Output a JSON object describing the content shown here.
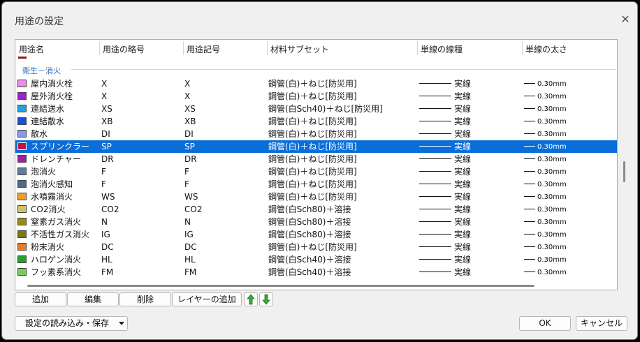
{
  "dialog": {
    "title": "用途の設定",
    "close_glyph": "✕"
  },
  "columns": [
    "用途名",
    "用途の略号",
    "用途記号",
    "材料サブセット",
    "単線の線種",
    "単線の太さ"
  ],
  "group_label": "衛生－消火",
  "rows": [
    {
      "name": "屋内消火栓",
      "abbr": "X",
      "symbol": "X",
      "subset": "鋼管(白)＋ねじ[防災用]",
      "linetype": "実線",
      "thickness": "0.30mm",
      "color": "#ee8be8"
    },
    {
      "name": "屋外消火栓",
      "abbr": "X",
      "symbol": "X",
      "subset": "鋼管(白)＋ねじ[防災用]",
      "linetype": "実線",
      "thickness": "0.30mm",
      "color": "#9b1fd6"
    },
    {
      "name": "連結送水",
      "abbr": "XS",
      "symbol": "XS",
      "subset": "鋼管(白Sch40)＋ねじ[防災用]",
      "linetype": "実線",
      "thickness": "0.30mm",
      "color": "#1ea3e6"
    },
    {
      "name": "連結散水",
      "abbr": "XB",
      "symbol": "XB",
      "subset": "鋼管(白)＋ねじ[防災用]",
      "linetype": "実線",
      "thickness": "0.30mm",
      "color": "#1a4fe0"
    },
    {
      "name": "散水",
      "abbr": "DI",
      "symbol": "DI",
      "subset": "鋼管(白)＋ねじ[防災用]",
      "linetype": "実線",
      "thickness": "0.30mm",
      "color": "#8899e6"
    },
    {
      "name": "スプリンクラー",
      "abbr": "SP",
      "symbol": "SP",
      "subset": "鋼管(白)＋ねじ[防災用]",
      "linetype": "実線",
      "thickness": "0.30mm",
      "color": "#c4163a",
      "selected": true
    },
    {
      "name": "ドレンチャー",
      "abbr": "DR",
      "symbol": "DR",
      "subset": "鋼管(白)＋ねじ[防災用]",
      "linetype": "実線",
      "thickness": "0.30mm",
      "color": "#a01ea6"
    },
    {
      "name": "泡消火",
      "abbr": "F",
      "symbol": "F",
      "subset": "鋼管(白)＋ねじ[防災用]",
      "linetype": "実線",
      "thickness": "0.30mm",
      "color": "#5f7da0"
    },
    {
      "name": "泡消火感知",
      "abbr": "F",
      "symbol": "F",
      "subset": "鋼管(白)＋ねじ[防災用]",
      "linetype": "実線",
      "thickness": "0.30mm",
      "color": "#4d6a8c"
    },
    {
      "name": "水噴霧消火",
      "abbr": "WS",
      "symbol": "WS",
      "subset": "鋼管(白)＋ねじ[防災用]",
      "linetype": "実線",
      "thickness": "0.30mm",
      "color": "#f0a020"
    },
    {
      "name": "CO2消火",
      "abbr": "CO2",
      "symbol": "CO2",
      "subset": "鋼管(白Sch80)＋溶接",
      "linetype": "実線",
      "thickness": "0.30mm",
      "color": "#c9c46a"
    },
    {
      "name": "窒素ガス消火",
      "abbr": "N",
      "symbol": "N",
      "subset": "鋼管(白Sch80)＋溶接",
      "linetype": "実線",
      "thickness": "0.30mm",
      "color": "#9a8a10"
    },
    {
      "name": "不活性ガス消火",
      "abbr": "IG",
      "symbol": "IG",
      "subset": "鋼管(白Sch80)＋溶接",
      "linetype": "実線",
      "thickness": "0.30mm",
      "color": "#7a7a10"
    },
    {
      "name": "粉末消火",
      "abbr": "DC",
      "symbol": "DC",
      "subset": "鋼管(白)＋ねじ[防災用]",
      "linetype": "実線",
      "thickness": "0.30mm",
      "color": "#f07a18"
    },
    {
      "name": "ハロゲン消火",
      "abbr": "HL",
      "symbol": "HL",
      "subset": "鋼管(白Sch40)＋溶接",
      "linetype": "実線",
      "thickness": "0.30mm",
      "color": "#2aa02a"
    },
    {
      "name": "フッ素系消火",
      "abbr": "FM",
      "symbol": "FM",
      "subset": "鋼管(白Sch40)＋溶接",
      "linetype": "実線",
      "thickness": "0.30mm",
      "color": "#6fcf5a"
    }
  ],
  "buttons": {
    "add": "追加",
    "edit": "編集",
    "delete": "削除",
    "add_layer": "レイヤーの追加",
    "ok": "OK",
    "cancel": "キャンセル"
  },
  "move": {
    "up_color": "#3aa83a",
    "down_color": "#3aa83a"
  },
  "dropdown": {
    "label": "設定の読み込み・保存"
  }
}
